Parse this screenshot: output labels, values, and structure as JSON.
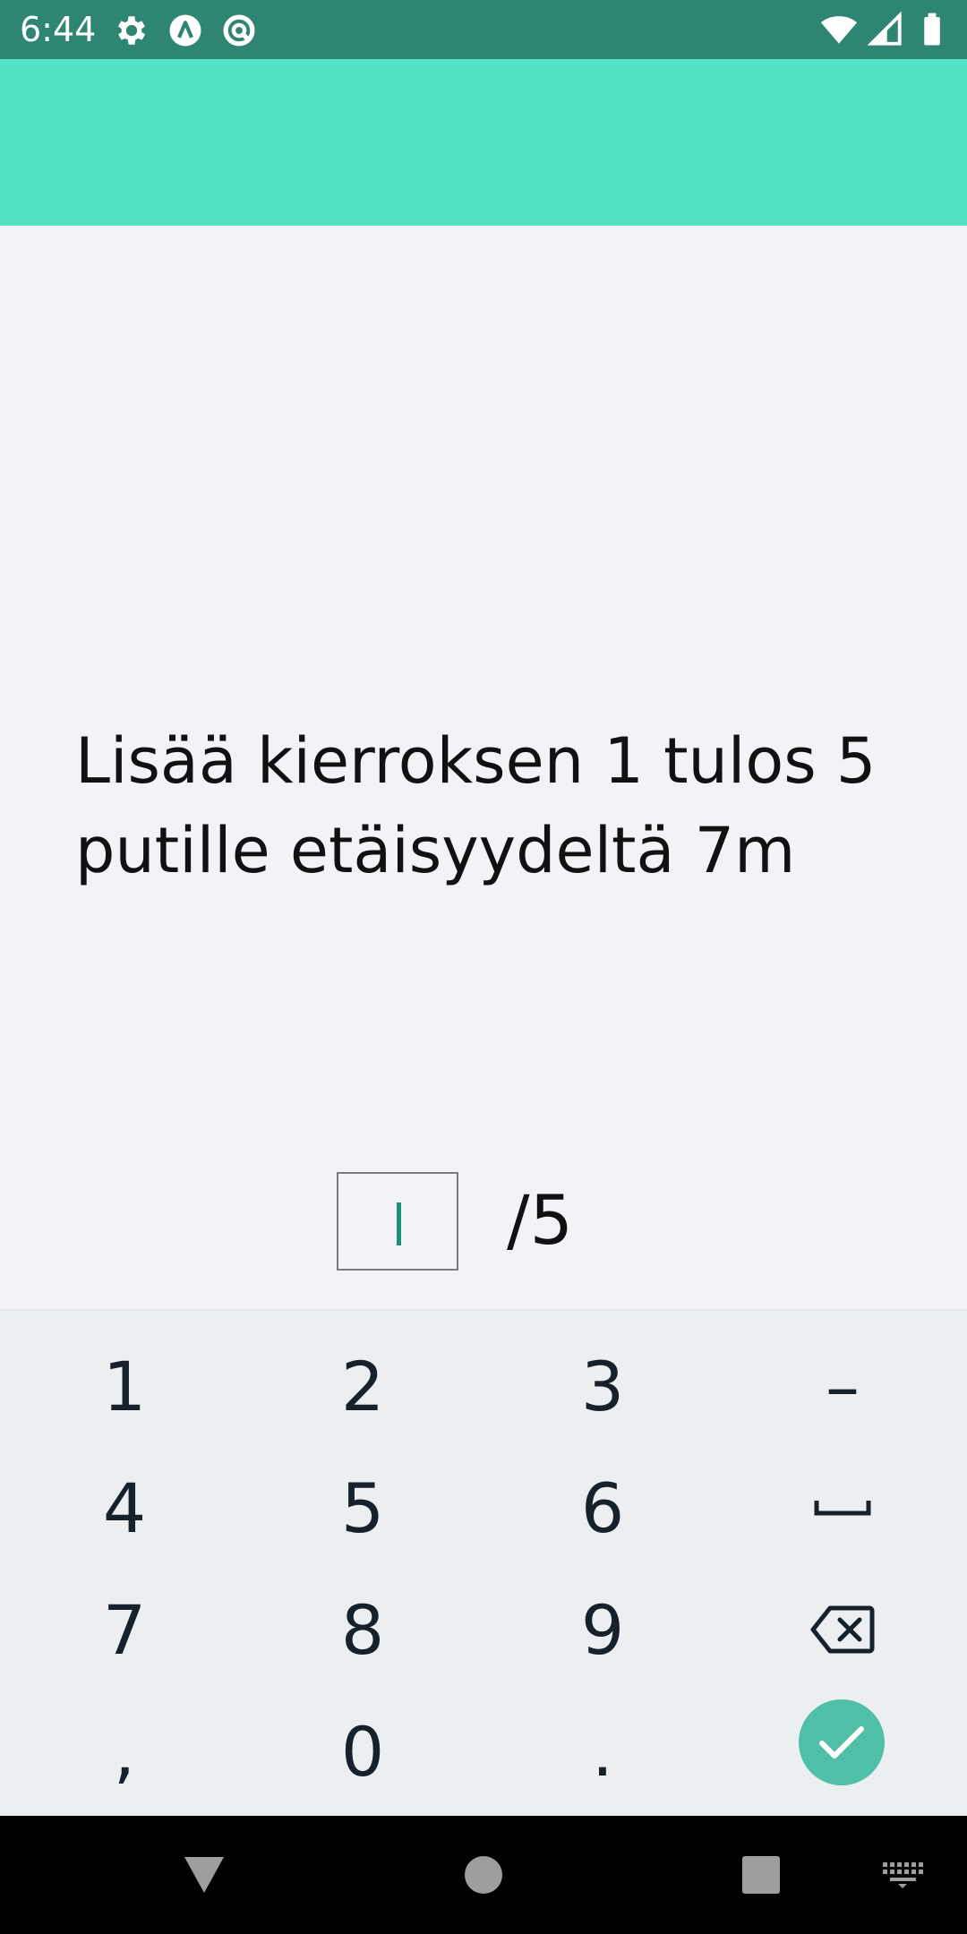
{
  "status_bar": {
    "time": "6:44",
    "left_icons": [
      "settings-gear-icon",
      "app-notification-icon",
      "data-saver-icon"
    ],
    "right_icons": [
      "wifi-icon",
      "cell-signal-icon",
      "battery-icon"
    ],
    "color": "#2e8572"
  },
  "app_bar": {
    "color": "#51e3c3"
  },
  "main": {
    "prompt": "Lisää kierroksen 1 tulos 5 putille etäisyydeltä 7m",
    "score_input": {
      "value": "",
      "placeholder": ""
    },
    "score_total": "/5"
  },
  "keyboard": {
    "rows": [
      [
        "1",
        "2",
        "3",
        "–"
      ],
      [
        "4",
        "5",
        "6",
        "space"
      ],
      [
        "7",
        "8",
        "9",
        "backspace"
      ],
      [
        ",",
        "0",
        ".",
        "done"
      ]
    ],
    "keys": {
      "k1": "1",
      "k2": "2",
      "k3": "3",
      "minus": "–",
      "k4": "4",
      "k5": "5",
      "k6": "6",
      "k7": "7",
      "k8": "8",
      "k9": "9",
      "comma": ",",
      "k0": "0",
      "period": "."
    },
    "icons": {
      "space": "space-bar-icon",
      "backspace": "backspace-icon",
      "done": "checkmark-icon"
    },
    "accent_color": "#4fbfa8"
  },
  "nav_bar": {
    "buttons": [
      "back-triangle-icon",
      "home-circle-icon",
      "recents-square-icon",
      "keyboard-switch-icon"
    ]
  }
}
